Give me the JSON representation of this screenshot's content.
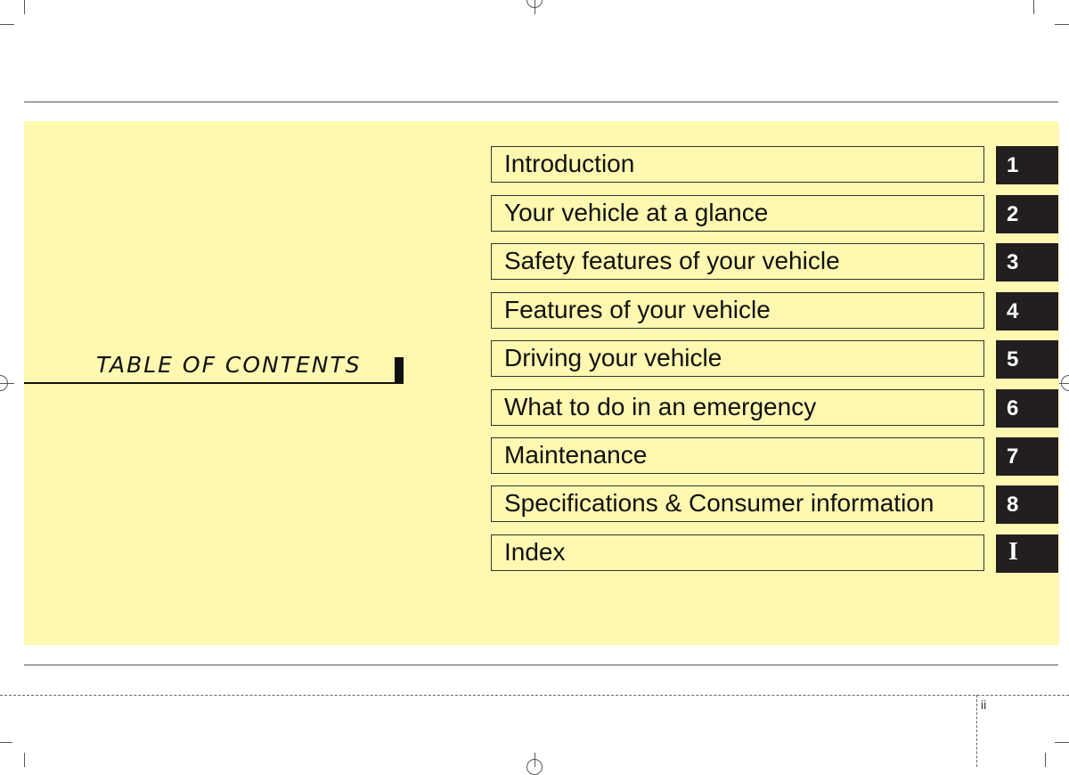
{
  "document": {
    "section_title": "TABLE OF CONTENTS",
    "page_number": "ii",
    "colors": {
      "panel_background": "#fff8b0",
      "tab_background": "#231f20",
      "tab_text": "#ffffff",
      "text": "#111111"
    }
  },
  "toc": {
    "entries": [
      {
        "label": "Introduction",
        "tab": "1"
      },
      {
        "label": "Your vehicle at a glance",
        "tab": "2"
      },
      {
        "label": "Safety features of your vehicle",
        "tab": "3"
      },
      {
        "label": "Features of your vehicle",
        "tab": "4"
      },
      {
        "label": "Driving your vehicle",
        "tab": "5"
      },
      {
        "label": "What to do in an emergency",
        "tab": "6"
      },
      {
        "label": "Maintenance",
        "tab": "7"
      },
      {
        "label": "Specifications & Consumer information",
        "tab": "8"
      },
      {
        "label": "Index",
        "tab": "I"
      }
    ]
  }
}
